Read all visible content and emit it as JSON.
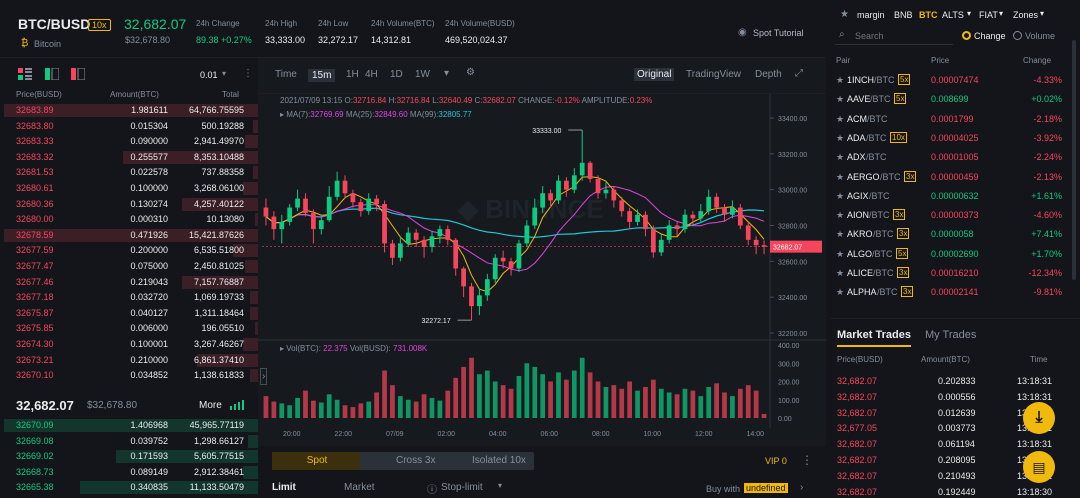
{
  "header": {
    "symbol": "BTC/BUSD",
    "leverage": "10x",
    "coin_name": "Bitcoin",
    "last_price": "32,682.07",
    "last_price_usd": "$32,678.80",
    "stats": [
      {
        "label": "24h Change",
        "value": "89.38 +0.27%"
      },
      {
        "label": "24h High",
        "value": "33,333.00"
      },
      {
        "label": "24h Low",
        "value": "32,272.17"
      },
      {
        "label": "24h Volume(BTC)",
        "value": "14,312.81"
      },
      {
        "label": "24h Volume(BUSD)",
        "value": "469,520,024.37"
      }
    ],
    "spot_tutorial": "Spot Tutorial"
  },
  "orderbook": {
    "precision": "0.01",
    "columns": [
      "Price(BUSD)",
      "Amount(BTC)",
      "Total"
    ],
    "asks": [
      {
        "price": "32683.89",
        "amount": "1.981611",
        "total": "64,766.75595",
        "depth": 1.0
      },
      {
        "price": "32683.80",
        "amount": "0.015304",
        "total": "500.19288",
        "depth": 0.02
      },
      {
        "price": "32683.33",
        "amount": "0.090000",
        "total": "2,941.49970",
        "depth": 0.05
      },
      {
        "price": "32683.32",
        "amount": "0.255577",
        "total": "8,353.10488",
        "depth": 0.53
      },
      {
        "price": "32681.53",
        "amount": "0.022578",
        "total": "737.88358",
        "depth": 0.02
      },
      {
        "price": "32680.61",
        "amount": "0.100000",
        "total": "3,268.06100",
        "depth": 0.06
      },
      {
        "price": "32680.36",
        "amount": "0.130274",
        "total": "4,257.40122",
        "depth": 0.3
      },
      {
        "price": "32680.00",
        "amount": "0.000310",
        "total": "10.13080",
        "depth": 0.01
      },
      {
        "price": "32678.59",
        "amount": "0.471926",
        "total": "15,421.87626",
        "depth": 1.0
      },
      {
        "price": "32677.59",
        "amount": "0.200000",
        "total": "6,535.51800",
        "depth": 0.1
      },
      {
        "price": "32677.47",
        "amount": "0.075000",
        "total": "2,450.81025",
        "depth": 0.05
      },
      {
        "price": "32677.46",
        "amount": "0.219043",
        "total": "7,157.76887",
        "depth": 0.3
      },
      {
        "price": "32677.18",
        "amount": "0.032720",
        "total": "1,069.19733",
        "depth": 0.03
      },
      {
        "price": "32675.87",
        "amount": "0.040127",
        "total": "1,311.18464",
        "depth": 0.03
      },
      {
        "price": "32675.85",
        "amount": "0.006000",
        "total": "196.05510",
        "depth": 0.01
      },
      {
        "price": "32674.30",
        "amount": "0.100001",
        "total": "3,267.46267",
        "depth": 0.06
      },
      {
        "price": "32673.21",
        "amount": "0.210000",
        "total": "6,861.37410",
        "depth": 0.24
      },
      {
        "price": "32670.10",
        "amount": "0.034852",
        "total": "1,138.61833",
        "depth": 0.03
      }
    ],
    "mid_price": "32,682.07",
    "mid_usd": "$32,678.80",
    "more": "More",
    "bids": [
      {
        "price": "32670.09",
        "amount": "1.406968",
        "total": "45,965.77119",
        "depth": 1.0
      },
      {
        "price": "32669.08",
        "amount": "0.039752",
        "total": "1,298.66127",
        "depth": 0.04
      },
      {
        "price": "32669.02",
        "amount": "0.171593",
        "total": "5,605.77515",
        "depth": 0.56
      },
      {
        "price": "32668.73",
        "amount": "0.089149",
        "total": "2,912.38461",
        "depth": 0.06
      },
      {
        "price": "32665.38",
        "amount": "0.340835",
        "total": "11,133.50479",
        "depth": 0.7
      }
    ]
  },
  "chart": {
    "intervals": [
      "Time",
      "15m",
      "1H",
      "4H",
      "1D",
      "1W"
    ],
    "active_interval": "15m",
    "views": [
      "Original",
      "TradingView",
      "Depth"
    ],
    "info_line": {
      "date": "2021/07/09 13:15",
      "o_label": "O:",
      "o": "32716.84",
      "h_label": "H:",
      "h": "32716.84",
      "l_label": "L:",
      "l": "32640.49",
      "c_label": "C:",
      "c": "32682.07",
      "change_label": "CHANGE:",
      "change": "-0.12%",
      "amp_label": "AMPLITUDE:",
      "amp": "0.23%"
    },
    "ma_line": {
      "ma7_label": "MA(7):",
      "ma7": "32769.69",
      "ma25_label": "MA(25):",
      "ma25": "32849.60",
      "ma99_label": "MA(99):",
      "ma99": "32805.77"
    },
    "vol_line": {
      "btc_label": "Vol(BTC):",
      "btc": "22.375",
      "busd_label": "Vol(BUSD):",
      "busd": "731.008K"
    },
    "high_marker": "33333.00",
    "low_marker": "32272.17",
    "last_marker": "32682.07",
    "y_ticks": [
      "33400.00",
      "33200.00",
      "33000.00",
      "32800.00",
      "32600.00",
      "32400.00",
      "32200.00"
    ],
    "vol_ticks": [
      "400.00",
      "300.00",
      "200.00",
      "100.00",
      "0.00"
    ],
    "x_ticks": [
      "20:00",
      "22:00",
      "07/09",
      "02:00",
      "04:00",
      "06:00",
      "08:00",
      "10:00",
      "12:00",
      "14:00"
    ]
  },
  "chart_data": {
    "type": "candlestick",
    "y_range": [
      32200,
      33400
    ],
    "candles": [
      [
        32900,
        32850,
        32950,
        32800
      ],
      [
        32850,
        32780,
        32880,
        32720
      ],
      [
        32780,
        32820,
        32860,
        32700
      ],
      [
        32820,
        32900,
        32920,
        32800
      ],
      [
        32900,
        32950,
        33000,
        32880
      ],
      [
        32950,
        32870,
        32980,
        32850
      ],
      [
        32870,
        32780,
        32890,
        32700
      ],
      [
        32780,
        32830,
        32860,
        32750
      ],
      [
        32830,
        32960,
        33020,
        32820
      ],
      [
        32960,
        33050,
        33100,
        32940
      ],
      [
        33050,
        32980,
        33080,
        32950
      ],
      [
        32980,
        32930,
        33000,
        32900
      ],
      [
        32930,
        32880,
        32950,
        32850
      ],
      [
        32880,
        32950,
        32980,
        32860
      ],
      [
        32950,
        32920,
        32970,
        32880
      ],
      [
        32920,
        32700,
        32940,
        32650
      ],
      [
        32700,
        32620,
        32720,
        32580
      ],
      [
        32620,
        32700,
        32740,
        32600
      ],
      [
        32700,
        32760,
        32790,
        32680
      ],
      [
        32760,
        32720,
        32780,
        32680
      ],
      [
        32720,
        32680,
        32740,
        32620
      ],
      [
        32680,
        32740,
        32770,
        32650
      ],
      [
        32740,
        32780,
        32800,
        32700
      ],
      [
        32780,
        32720,
        32800,
        32690
      ],
      [
        32720,
        32560,
        32730,
        32520
      ],
      [
        32560,
        32460,
        32570,
        32400
      ],
      [
        32460,
        32350,
        32480,
        32272
      ],
      [
        32350,
        32410,
        32450,
        32300
      ],
      [
        32410,
        32500,
        32530,
        32380
      ],
      [
        32500,
        32620,
        32640,
        32480
      ],
      [
        32620,
        32600,
        32660,
        32560
      ],
      [
        32600,
        32560,
        32620,
        32520
      ],
      [
        32560,
        32700,
        32720,
        32540
      ],
      [
        32700,
        32800,
        32830,
        32680
      ],
      [
        32800,
        32900,
        32950,
        32780
      ],
      [
        32900,
        32980,
        33020,
        32870
      ],
      [
        32980,
        32940,
        33000,
        32900
      ],
      [
        32940,
        33050,
        33080,
        32920
      ],
      [
        33050,
        33000,
        33070,
        32960
      ],
      [
        33000,
        33080,
        33120,
        32980
      ],
      [
        33080,
        33150,
        33333,
        33050
      ],
      [
        33150,
        33060,
        33160,
        33040
      ],
      [
        33060,
        32980,
        33080,
        32950
      ],
      [
        32980,
        33000,
        33040,
        32950
      ],
      [
        33000,
        32940,
        33020,
        32900
      ],
      [
        32940,
        32880,
        32960,
        32850
      ],
      [
        32880,
        32820,
        32900,
        32780
      ],
      [
        32820,
        32860,
        32890,
        32800
      ],
      [
        32860,
        32780,
        32880,
        32740
      ],
      [
        32780,
        32650,
        32800,
        32620
      ],
      [
        32650,
        32720,
        32750,
        32630
      ],
      [
        32720,
        32800,
        32830,
        32700
      ],
      [
        32800,
        32780,
        32820,
        32740
      ],
      [
        32780,
        32860,
        32890,
        32760
      ],
      [
        32860,
        32840,
        32880,
        32800
      ],
      [
        32840,
        32880,
        32920,
        32820
      ],
      [
        32880,
        32960,
        33000,
        32860
      ],
      [
        32960,
        32900,
        32980,
        32870
      ],
      [
        32900,
        32860,
        32920,
        32820
      ],
      [
        32860,
        32900,
        32940,
        32840
      ],
      [
        32900,
        32800,
        32920,
        32780
      ],
      [
        32800,
        32720,
        32820,
        32690
      ],
      [
        32720,
        32690,
        32740,
        32640
      ],
      [
        32690,
        32682,
        32717,
        32640
      ]
    ],
    "volumes": [
      120,
      90,
      80,
      70,
      110,
      150,
      95,
      85,
      130,
      100,
      70,
      60,
      80,
      90,
      140,
      260,
      180,
      120,
      100,
      90,
      130,
      110,
      95,
      150,
      220,
      280,
      330,
      240,
      260,
      200,
      180,
      160,
      230,
      300,
      280,
      240,
      200,
      250,
      210,
      260,
      330,
      250,
      200,
      170,
      180,
      160,
      200,
      150,
      170,
      210,
      160,
      140,
      130,
      160,
      150,
      120,
      170,
      190,
      140,
      120,
      160,
      180,
      150,
      22
    ]
  },
  "trade_form": {
    "tabs": [
      "Spot",
      "Cross 3x",
      "Isolated 10x"
    ],
    "vip": "VIP 0",
    "order_types": [
      "Limit",
      "Market",
      "Stop-limit"
    ],
    "buy_with_label": "Buy with",
    "buy_with_value": "undefined"
  },
  "market": {
    "filters": [
      "margin",
      "BNB",
      "BTC",
      "ALTS",
      "FIAT",
      "Zones"
    ],
    "search_placeholder": "Search",
    "toggle": [
      "Change",
      "Volume"
    ],
    "columns": [
      "Pair",
      "Price",
      "Change"
    ],
    "pairs": [
      {
        "base": "1INCH",
        "quote": "/BTC",
        "lev": "5x",
        "price": "0.00007474",
        "change": "-4.33%",
        "up": false
      },
      {
        "base": "AAVE",
        "quote": "/BTC",
        "lev": "5x",
        "price": "0.008699",
        "change": "+0.02%",
        "up": true
      },
      {
        "base": "ACM",
        "quote": "/BTC",
        "lev": "",
        "price": "0.0001799",
        "change": "-2.18%",
        "up": false
      },
      {
        "base": "ADA",
        "quote": "/BTC",
        "lev": "10x",
        "price": "0.00004025",
        "change": "-3.92%",
        "up": false
      },
      {
        "base": "ADX",
        "quote": "/BTC",
        "lev": "",
        "price": "0.00001005",
        "change": "-2.24%",
        "up": false
      },
      {
        "base": "AERGO",
        "quote": "/BTC",
        "lev": "3x",
        "price": "0.00000459",
        "change": "-2.13%",
        "up": false
      },
      {
        "base": "AGIX",
        "quote": "/BTC",
        "lev": "",
        "price": "0.00000632",
        "change": "+1.61%",
        "up": true
      },
      {
        "base": "AION",
        "quote": "/BTC",
        "lev": "3x",
        "price": "0.00000373",
        "change": "-4.60%",
        "up": false
      },
      {
        "base": "AKRO",
        "quote": "/BTC",
        "lev": "3x",
        "price": "0.0000058",
        "change": "+7.41%",
        "up": true
      },
      {
        "base": "ALGO",
        "quote": "/BTC",
        "lev": "5x",
        "price": "0.00002690",
        "change": "+1.70%",
        "up": true
      },
      {
        "base": "ALICE",
        "quote": "/BTC",
        "lev": "3x",
        "price": "0.00016210",
        "change": "-12.34%",
        "up": false
      },
      {
        "base": "ALPHA",
        "quote": "/BTC",
        "lev": "3x",
        "price": "0.00002141",
        "change": "-9.81%",
        "up": false
      }
    ],
    "trades_tabs": [
      "Market Trades",
      "My Trades"
    ],
    "trades_columns": [
      "Price(BUSD)",
      "Amount(BTC)",
      "Time"
    ],
    "trades": [
      {
        "price": "32,682.07",
        "amount": "0.202833",
        "time": "13:18:31"
      },
      {
        "price": "32,682.07",
        "amount": "0.000556",
        "time": "13:18:31"
      },
      {
        "price": "32,682.07",
        "amount": "0.012639",
        "time": "13:18:31"
      },
      {
        "price": "32,677.05",
        "amount": "0.003773",
        "time": "13:18:31"
      },
      {
        "price": "32,682.07",
        "amount": "0.061194",
        "time": "13:18:31"
      },
      {
        "price": "32,682.07",
        "amount": "0.208095",
        "time": "13:18:31"
      },
      {
        "price": "32,682.07",
        "amount": "0.210493",
        "time": "13:18:31"
      },
      {
        "price": "32,682.07",
        "amount": "0.192449",
        "time": "13:18:30"
      }
    ]
  },
  "colors": {
    "up": "#0ecb81",
    "down": "#f6465d",
    "accent": "#f0b90b",
    "ma7": "#f0b90b",
    "ma25": "#e045e0",
    "ma99": "#1fc7d4"
  }
}
